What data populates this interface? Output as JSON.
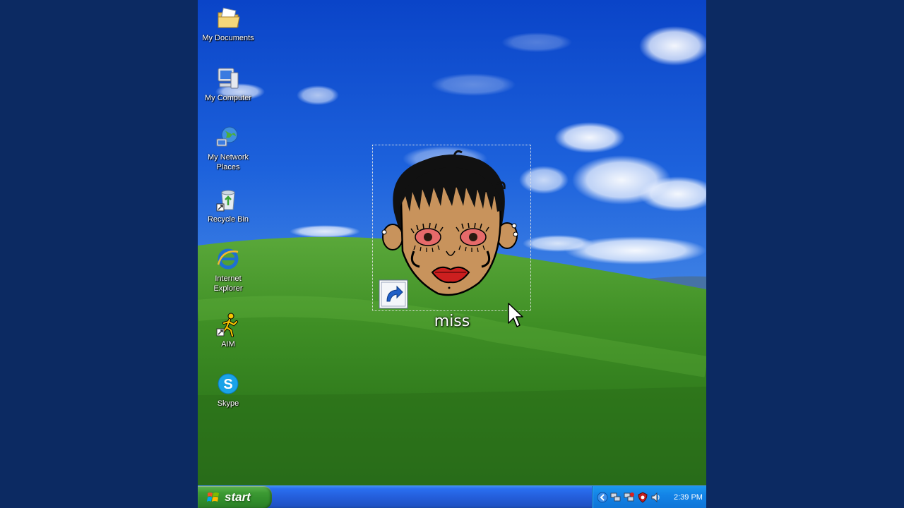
{
  "desktop": {
    "icons": [
      {
        "label": "My Documents"
      },
      {
        "label": "My Computer"
      },
      {
        "label": "My Network\nPlaces"
      },
      {
        "label": "Recycle Bin"
      },
      {
        "label": "Internet\nExplorer"
      },
      {
        "label": "AIM"
      },
      {
        "label": "Skype"
      }
    ],
    "selected_shortcut": {
      "label": "miss"
    }
  },
  "taskbar": {
    "start_label": "start",
    "clock": "2:39 PM"
  },
  "colors": {
    "sky": "#1f5fd8",
    "grass": "#3f8f2b",
    "taskbar": "#245edb",
    "start_green": "#3c9a33",
    "tray": "#1383e6"
  }
}
